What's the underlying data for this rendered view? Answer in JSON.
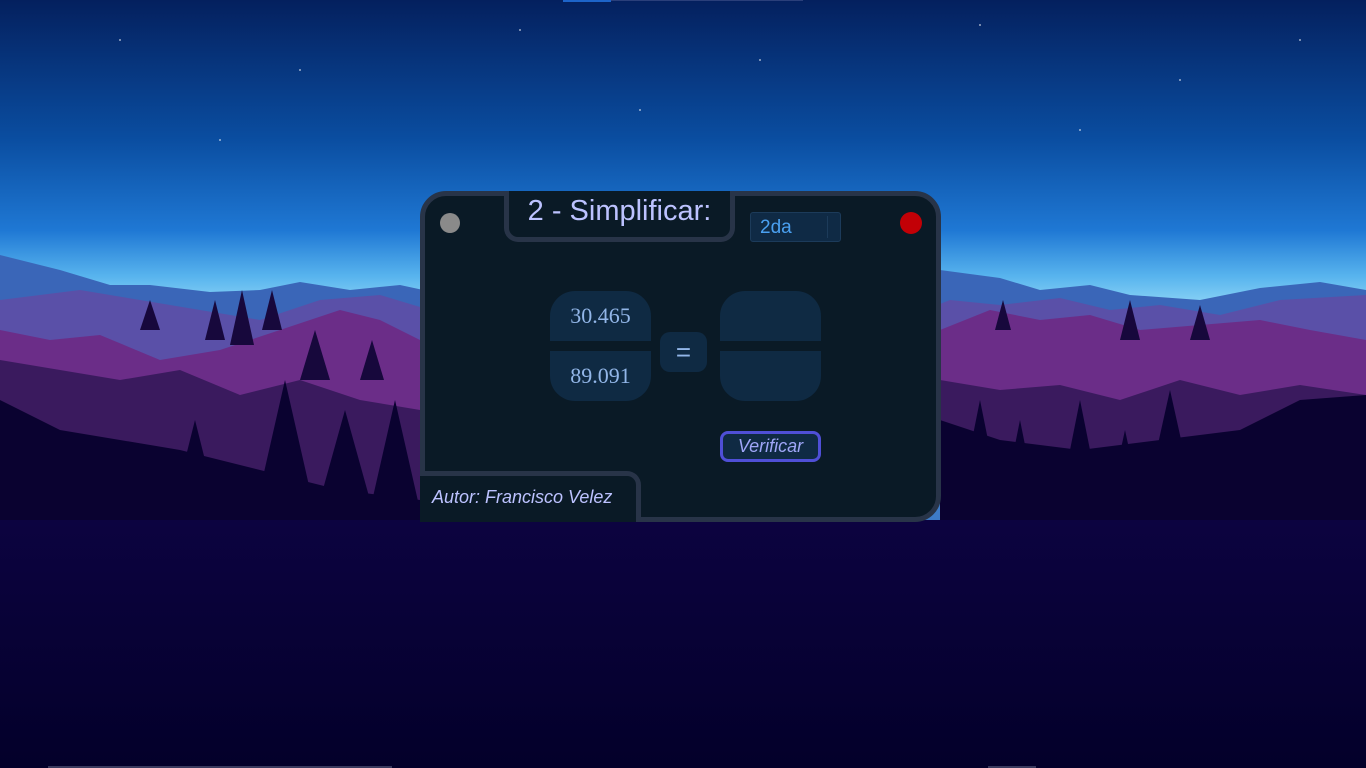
{
  "window": {
    "title": "2 - Simplificar:",
    "level_select": {
      "value": "2da"
    },
    "fraction": {
      "given_numerator": "30.465",
      "given_denominator": "89.091",
      "equals": "="
    },
    "answer": {
      "numerator": "",
      "denominator": ""
    },
    "verify_label": "Verificar",
    "author": "Autor: Francisco Velez"
  },
  "colors": {
    "window_bg": "#0a1a26",
    "window_border": "#283448",
    "title_text": "#bcc2ff",
    "pill_bg": "#0f2a43",
    "pill_text": "#92b6e8",
    "close_dot": "#c20006",
    "minimize_dot": "#8a8a8a",
    "verify_border": "#4f4fd6"
  }
}
